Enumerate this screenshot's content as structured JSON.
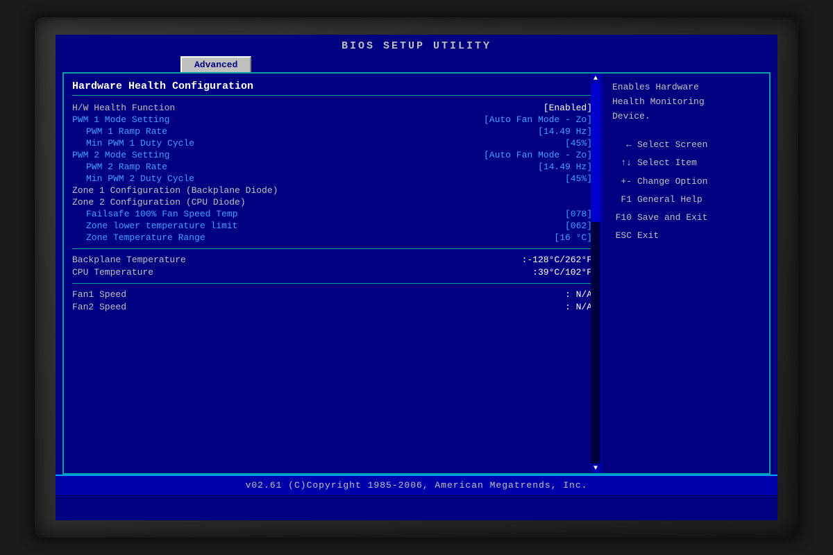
{
  "title": "BIOS  SETUP  UTILITY",
  "tab": "Advanced",
  "section_header": "Hardware Health Configuration",
  "rows": [
    {
      "label": "H/W Health Function",
      "value": "[Enabled]",
      "indent": false,
      "blue_label": false
    },
    {
      "label": "PWM 1 Mode Setting",
      "value": "[Auto Fan Mode - Zo]",
      "indent": false,
      "blue_label": true
    },
    {
      "label": "PWM 1 Ramp Rate",
      "value": "[14.49 Hz]",
      "indent": true,
      "blue_label": true
    },
    {
      "label": "Min PWM 1 Duty Cycle",
      "value": "[45%]",
      "indent": true,
      "blue_label": true
    },
    {
      "label": "PWM 2 Mode Setting",
      "value": "[Auto Fan Mode - Zo]",
      "indent": false,
      "blue_label": true
    },
    {
      "label": "PWM 2 Ramp Rate",
      "value": "[14.49 Hz]",
      "indent": true,
      "blue_label": true
    },
    {
      "label": "Min PWM 2 Duty Cycle",
      "value": "[45%]",
      "indent": true,
      "blue_label": true
    },
    {
      "label": "Zone 1 Configuration (Backplane Diode)",
      "value": "",
      "indent": false,
      "blue_label": false
    },
    {
      "label": "Zone 2 Configuration (CPU Diode)",
      "value": "",
      "indent": false,
      "blue_label": false
    },
    {
      "label": "Failsafe 100% Fan Speed Temp",
      "value": "[078]",
      "indent": true,
      "blue_label": true
    },
    {
      "label": "Zone lower temperature limit",
      "value": "[062]",
      "indent": true,
      "blue_label": true
    },
    {
      "label": "Zone Temperature Range",
      "value": "[16     °C]",
      "indent": true,
      "blue_label": true
    }
  ],
  "temps": [
    {
      "label": "Backplane Temperature",
      "value": ":-128°C/262°F"
    },
    {
      "label": "CPU Temperature",
      "value": ":39°C/102°F"
    }
  ],
  "fans": [
    {
      "label": "Fan1 Speed",
      "value": ": N/A"
    },
    {
      "label": "Fan2 Speed",
      "value": ": N/A"
    }
  ],
  "help": {
    "line1": "Enables Hardware",
    "line2": "Health Monitoring",
    "line3": "Device."
  },
  "keys": [
    {
      "sym": "←",
      "desc": "Select Screen"
    },
    {
      "sym": "↑↓",
      "desc": "Select Item"
    },
    {
      "sym": "+-",
      "desc": "Change Option"
    },
    {
      "sym": "F1",
      "desc": "General Help"
    },
    {
      "sym": "F10",
      "desc": "Save and Exit"
    },
    {
      "sym": "ESC",
      "desc": "Exit"
    }
  ],
  "footer": "v02.61  (C)Copyright 1985-2006, American Megatrends, Inc."
}
